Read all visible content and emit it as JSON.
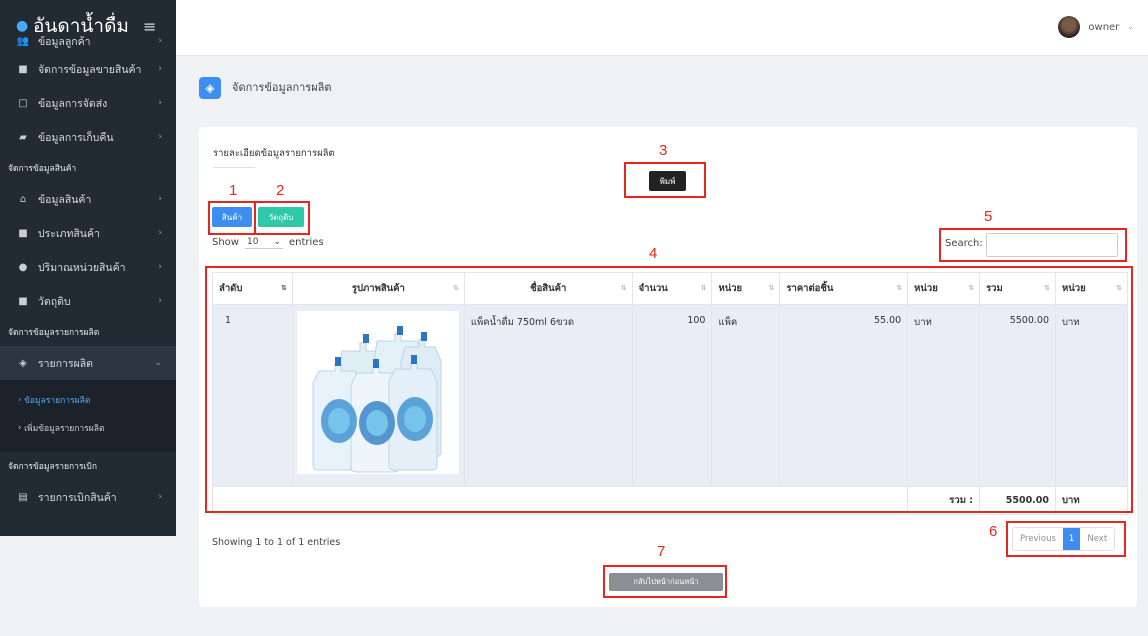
{
  "brand": {
    "name": "อันดาน้ำดื่ม"
  },
  "user": {
    "name": "owner"
  },
  "sidebar": {
    "items_top": [
      {
        "label": "ข้อมูลลูกค้า",
        "icon": "users-icon",
        "glyph": "👥"
      },
      {
        "label": "จัดการข้อมูลขายสินค้า",
        "icon": "shopping-bag-icon",
        "glyph": "■"
      },
      {
        "label": "ข้อมูลการจัดส่ง",
        "icon": "box-icon",
        "glyph": "□"
      },
      {
        "label": "ข้อมูลการเก็บคืน",
        "icon": "truck-icon",
        "glyph": "▰"
      }
    ],
    "section_products": "จัดการข้อมูลสินค้า",
    "items_products": [
      {
        "label": "ข้อมูลสินค้า",
        "icon": "basket-icon",
        "glyph": "⌂"
      },
      {
        "label": "ประเภทสินค้า",
        "icon": "bag-icon",
        "glyph": "■"
      },
      {
        "label": "ปริมาณหน่วยสินค้า",
        "icon": "circle-icon",
        "glyph": "●"
      },
      {
        "label": "วัตถุดิบ",
        "icon": "square-icon",
        "glyph": "■"
      }
    ],
    "section_production": "จัดการข้อมูลรายการผลิต",
    "item_production": {
      "label": "รายการผลิต",
      "glyph": "◈"
    },
    "sub_items": [
      "ข้อมูลรายการผลิต",
      "เพิ่มข้อมูลรายการผลิต"
    ],
    "section_withdraw": "จัดการข้อมูลรายการเบิก",
    "item_withdraw": {
      "label": "รายการเบิกสินค้า",
      "glyph": "▤"
    }
  },
  "page": {
    "title": "จัดการข้อมูลการผลิต"
  },
  "card": {
    "title": "รายละเอียดข้อมูลรายการผลิต",
    "print_label": "พิมพ์",
    "product_label": "สินค้า",
    "material_label": "วัตถุดิบ",
    "show_label": "Show",
    "entries_value": "10",
    "entries_label": "entries",
    "search_label": "Search:",
    "search_value": "",
    "info": "Showing 1 to 1 of 1 entries",
    "back_label": "กลับไปหน้าก่อนหน้า"
  },
  "table": {
    "headers": [
      "ลำดับ",
      "รูปภาพสินค้า",
      "ชื่อสินค้า",
      "จำนวน",
      "หน่วย",
      "ราคาต่อชิ้น",
      "หน่วย",
      "รวม",
      "หน่วย"
    ],
    "rows": [
      {
        "no": "1",
        "name": "แพ็คน้ำดื่ม 750ml 6ขวด",
        "qty": "100",
        "unit": "แพ็ค",
        "price": "55.00",
        "price_unit": "บาท",
        "total": "5500.00",
        "total_unit": "บาท"
      }
    ],
    "footer": {
      "label": "รวม :",
      "total": "5500.00",
      "unit": "บาท"
    }
  },
  "pager": {
    "previous": "Previous",
    "current": "1",
    "next": "Next"
  },
  "annotations": [
    "1",
    "2",
    "3",
    "4",
    "5",
    "6",
    "7"
  ],
  "colors": {
    "primary": "#3d8ef0",
    "teal": "#2fc8a9",
    "sidebar": "#222a33",
    "annotation": "#e8261f"
  }
}
